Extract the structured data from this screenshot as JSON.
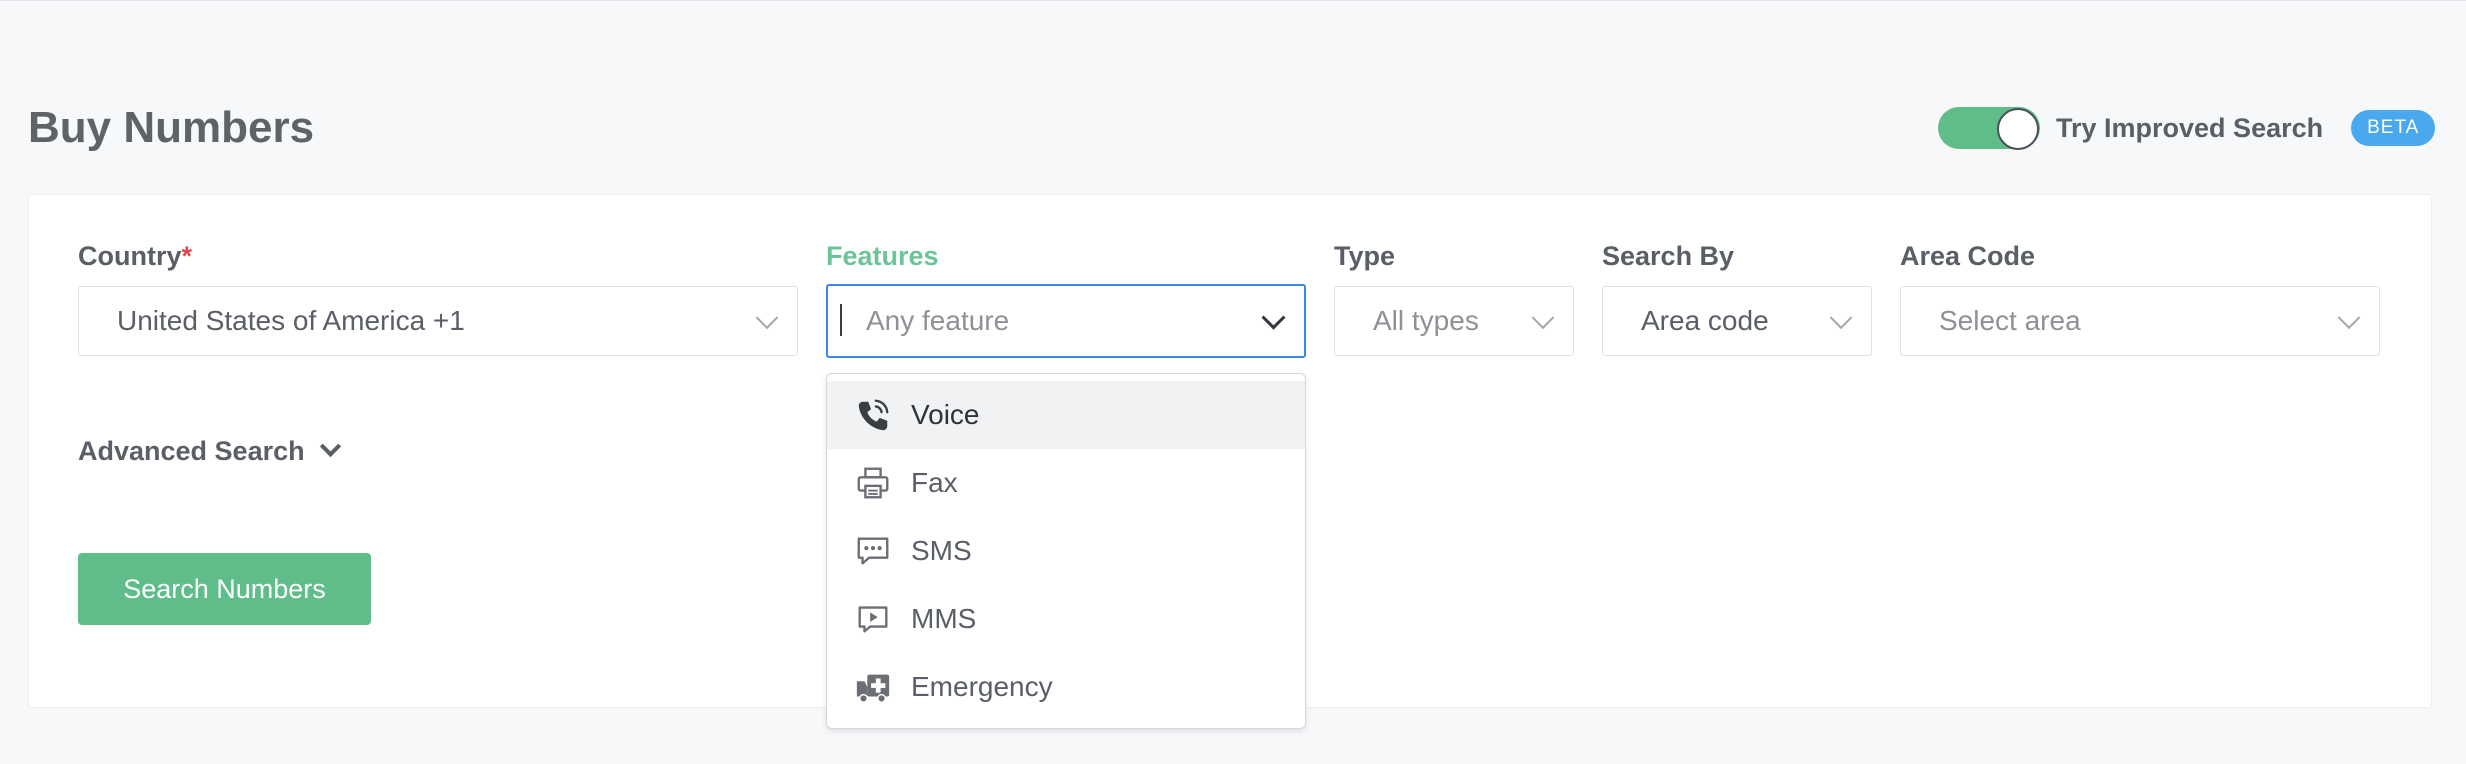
{
  "header": {
    "title": "Buy Numbers",
    "improved_search_label": "Try Improved Search",
    "improved_search_on": true,
    "beta_badge": "BETA"
  },
  "form": {
    "country": {
      "label": "Country",
      "required_mark": "*",
      "value": "United States of America +1"
    },
    "features": {
      "label": "Features",
      "placeholder": "Any feature"
    },
    "type": {
      "label": "Type",
      "placeholder": "All types"
    },
    "search_by": {
      "label": "Search By",
      "value": "Area code"
    },
    "area_code": {
      "label": "Area Code",
      "placeholder": "Select area"
    },
    "advanced_search_label": "Advanced Search",
    "search_button": "Search Numbers"
  },
  "features_dropdown": {
    "options": [
      {
        "label": "Voice",
        "icon": "phone-icon"
      },
      {
        "label": "Fax",
        "icon": "fax-icon"
      },
      {
        "label": "SMS",
        "icon": "sms-icon"
      },
      {
        "label": "MMS",
        "icon": "mms-icon"
      },
      {
        "label": "Emergency",
        "icon": "ambulance-icon"
      }
    ],
    "highlighted": "Voice"
  },
  "colors": {
    "accent_green": "#5fbd8a",
    "focus_blue": "#3b87e6",
    "beta_blue": "#4aa8ee",
    "required_red": "#e0454d"
  }
}
